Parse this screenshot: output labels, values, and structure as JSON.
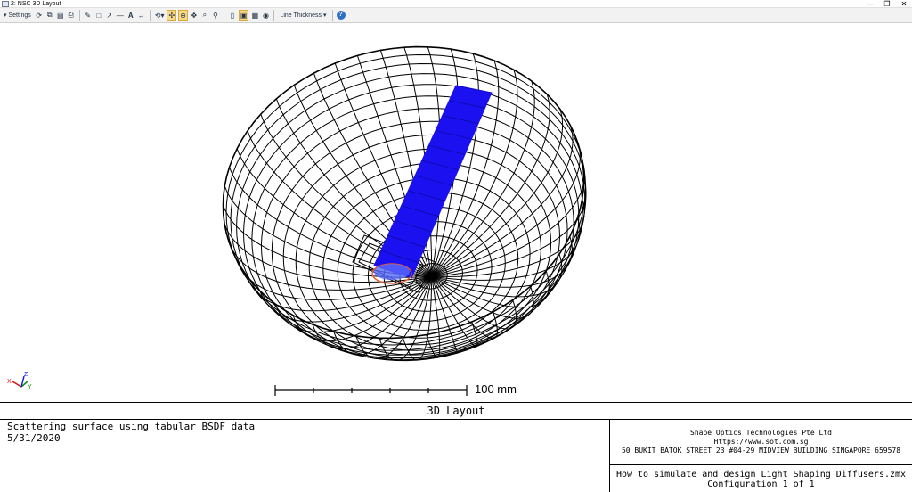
{
  "window": {
    "title": "2: NSC 3D Layout",
    "controls": {
      "minimize": "—",
      "restore": "❐",
      "close": "✕"
    }
  },
  "toolbar": {
    "settings_label": "Settings",
    "line_thickness_label": "Line Thickness",
    "icons": [
      "refresh-icon",
      "copy-icon",
      "save-icon",
      "print-icon",
      "pencil-icon",
      "rectangle-icon",
      "arrow-icon",
      "line-icon",
      "text-icon",
      "dimension-icon",
      "rotate-icon",
      "zoom-icon",
      "pan-icon",
      "fit-icon",
      "clipboard-icon",
      "export-icon",
      "help-icon"
    ]
  },
  "plot": {
    "scale_bar_label": "100 mm",
    "axis_labels": {
      "x": "X",
      "y": "Y",
      "z": "Z"
    },
    "colors": {
      "wire": "#000000",
      "beam": "#1a10f0",
      "source_ring": "#e8552a",
      "axis_x": "#e01010",
      "axis_y": "#109010",
      "axis_z": "#1020e0"
    }
  },
  "footer": {
    "title": "3D Layout",
    "left_line1": "Scattering surface using tabular BSDF data",
    "left_line2": "5/31/2020",
    "company": "Shape Optics Technologies Pte Ltd",
    "website": "Https://www.sot.com.sg",
    "address": "50 BUKIT BATOK STREET 23 #04-29 MIDVIEW BUILDING SINGAPORE 659578",
    "filename": "How to simulate and design Light Shaping Diffusers.zmx",
    "configuration": "Configuration 1 of 1"
  }
}
